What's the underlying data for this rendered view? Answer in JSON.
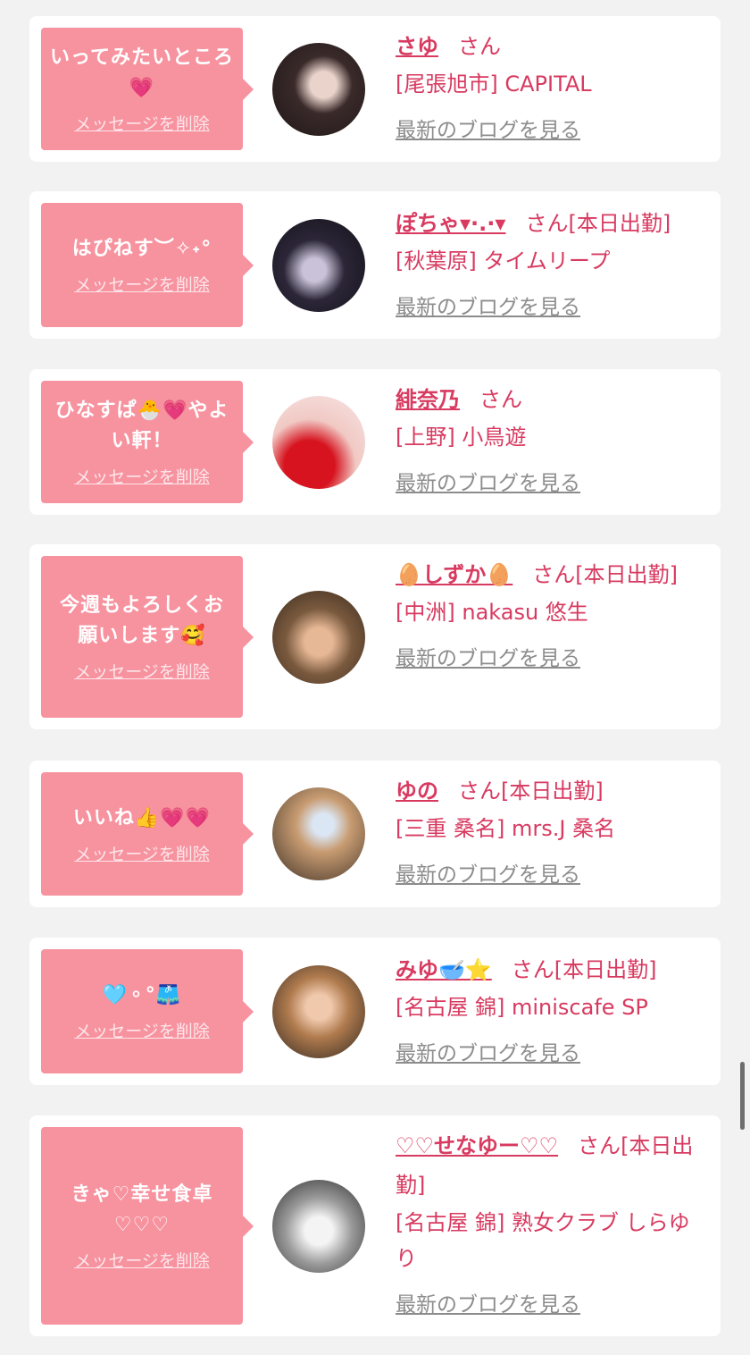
{
  "common": {
    "delete_label": "メッセージを削除",
    "blog_label": "最新のブログを見る",
    "honorific": "さん"
  },
  "items": [
    {
      "message": "いってみたいところ💗",
      "name": "さゆ",
      "status": "",
      "shop": "[尾張旭市] CAPITAL"
    },
    {
      "message": "はぴねす︶✧˖°",
      "name": "ぽちゃ▾·.·▾",
      "status": "[本日出勤]",
      "shop": "[秋葉原] タイムリープ"
    },
    {
      "message": "ひなすぱ🐣💗やよい軒！",
      "name": "緋奈乃",
      "status": "",
      "shop": "[上野] 小鳥遊"
    },
    {
      "message": "今週もよろしくお願いします🥰",
      "name": "🥚しずか🥚",
      "status": "[本日出勤]",
      "shop": "[中洲] nakasu 悠生"
    },
    {
      "message": "いいね👍💗💗",
      "name": "ゆの",
      "status": "[本日出勤]",
      "shop": "[三重 桑名] mrs.J 桑名"
    },
    {
      "message": "🩵⚬°🩳",
      "name": "みゆ🥣⭐",
      "status": "[本日出勤]",
      "shop": "[名古屋 錦] miniscafe SP"
    },
    {
      "message": "きゃ♡幸せ食卓♡♡♡",
      "name": "♡♡せなゆー♡♡",
      "status": "[本日出勤]",
      "shop": "[名古屋 錦] 熟女クラブ しらゆり"
    }
  ]
}
